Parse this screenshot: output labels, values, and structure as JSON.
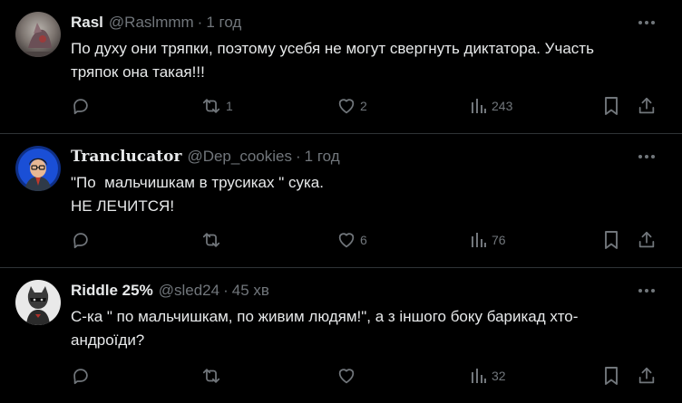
{
  "tweets": [
    {
      "name": "Rasl",
      "handle": "@Raslmmm",
      "time": "1 год",
      "lines": [
        "По духу они тряпки, поэтому усебя не могут свергнуть диктатора. Участь",
        "тряпок она такая!!!"
      ],
      "retweets": "1",
      "likes": "2",
      "views": "243"
    },
    {
      "name": "Tranclucator",
      "handle": "@Dep_cookies",
      "time": "1 год",
      "lines": [
        "\"По  мальчишкам в трусиках \" сука.",
        "НЕ ЛЕЧИТСЯ!"
      ],
      "retweets": "",
      "likes": "6",
      "views": "76"
    },
    {
      "name": "Riddle 25%",
      "handle": "@sled24",
      "time": "45 хв",
      "lines": [
        "С-ка \" по мальчишкам, по живим людям!\", а з іншого боку барикад хто-",
        "андроїди?"
      ],
      "retweets": "",
      "likes": "",
      "views": "32"
    }
  ],
  "separator": "·",
  "icons": {
    "more": "more-horizontal-icon",
    "reply": "reply-bubble-icon",
    "retweet": "retweet-icon",
    "like": "heart-icon",
    "views": "analytics-bars-icon",
    "bookmark": "bookmark-icon",
    "share": "share-upload-icon"
  },
  "colors": {
    "background": "#000000",
    "text": "#e7e9ea",
    "muted": "#71767b",
    "divider": "#2f3336"
  }
}
